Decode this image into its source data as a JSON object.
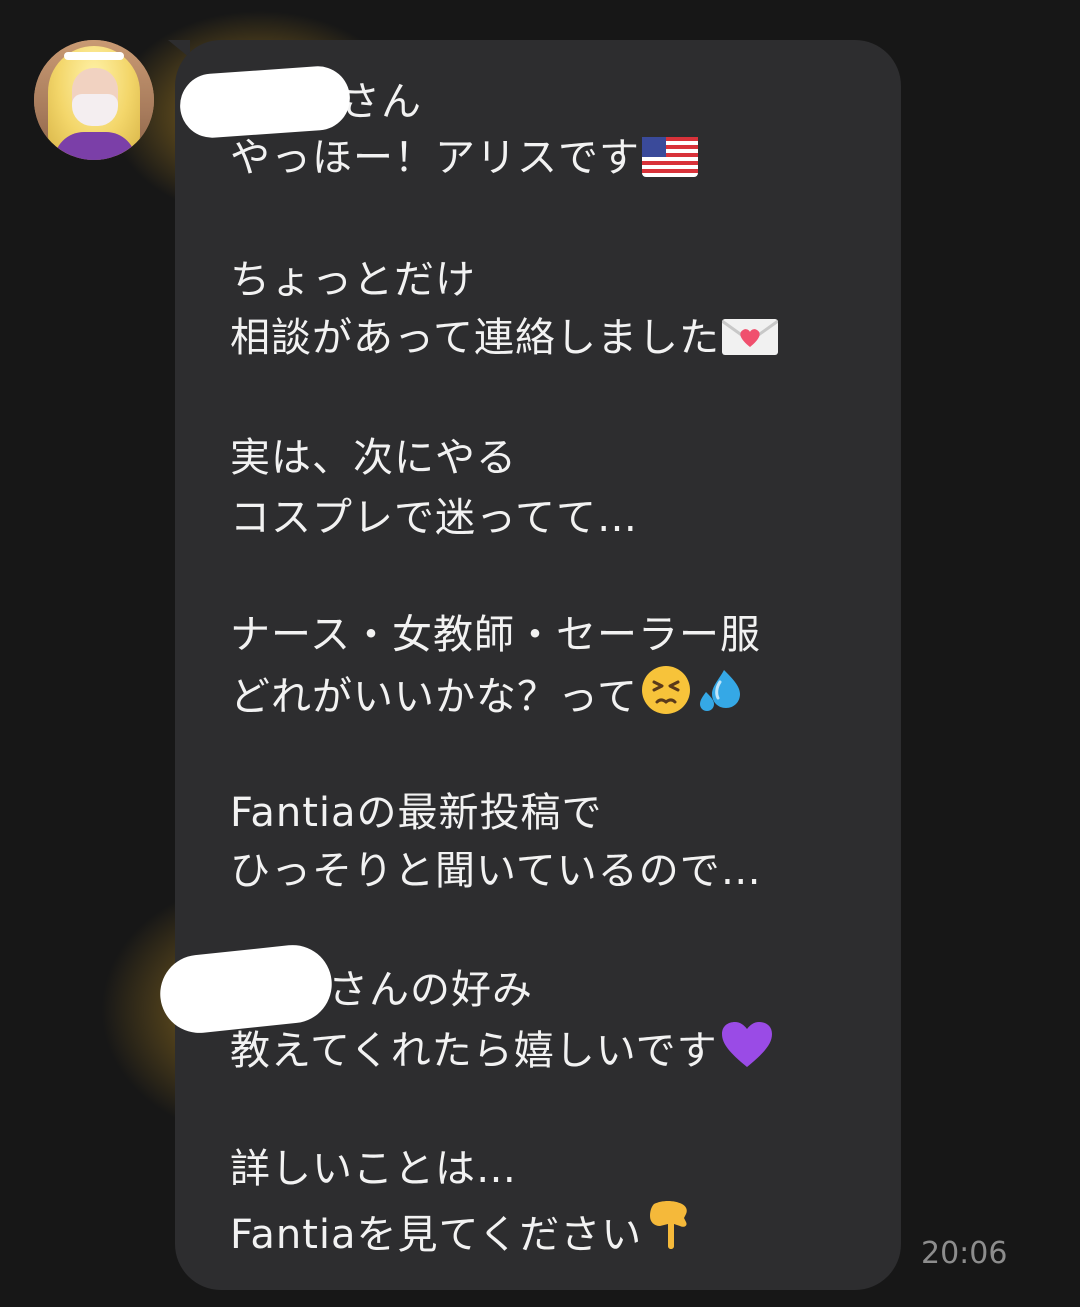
{
  "message": {
    "line_1": "さん",
    "line_2": "やっほー！アリスです",
    "line_3": "ちょっとだけ",
    "line_4": "相談があって連絡しました",
    "line_5": "実は、次にやる",
    "line_6": "コスプレで迷ってて…",
    "line_7": "ナース・女教師・セーラー服",
    "line_8": "どれがいいかな？って",
    "line_9": "Fantiaの最新投稿で",
    "line_10": "ひっそりと聞いているので…",
    "line_11": "さんの好み",
    "line_12": "教えてくれたら嬉しいです",
    "line_13": "詳しいことは…",
    "line_14": "Fantiaを見てください",
    "timestamp": "20:06"
  },
  "icons": {
    "avatar": "avatar",
    "us_flag": "us-flag-icon",
    "love_letter": "love-letter-icon",
    "persevering_face": "persevering-face-icon",
    "sweat_droplets": "sweat-droplets-icon",
    "purple_heart": "purple-heart-icon",
    "pointing_down": "backhand-index-pointing-down-icon"
  },
  "colors": {
    "background": "#171717",
    "bubble": "#2d2d2f",
    "text": "#f2f2f2",
    "timestamp": "#8d8d8d"
  }
}
